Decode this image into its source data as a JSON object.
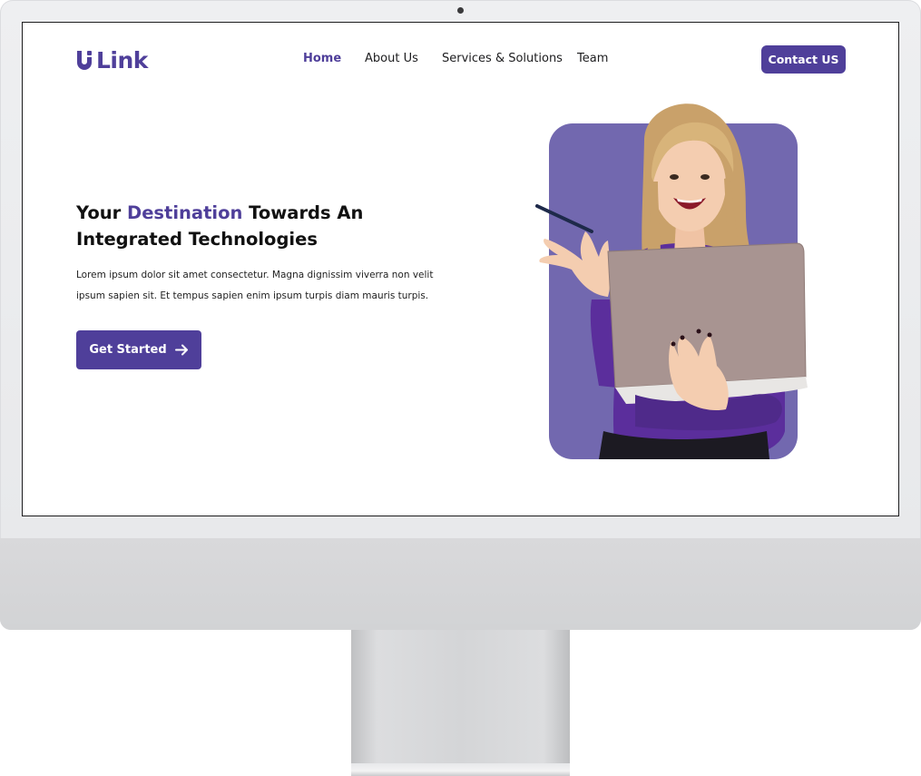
{
  "brand": {
    "name": "Link",
    "color": "#4f3f9a",
    "logo_icon": "u-logo-mark-icon"
  },
  "nav": {
    "items": [
      {
        "label": "Home",
        "active": true
      },
      {
        "label": "About Us",
        "active": false
      },
      {
        "label": "Services & Solutions",
        "active": false
      },
      {
        "label": "Team",
        "active": false
      }
    ],
    "contact_label": "Contact US"
  },
  "hero": {
    "title_prefix": "Your ",
    "title_accent": "Destination",
    "title_suffix": " Towards An Integrated Technologies",
    "body_line1": "Lorem ipsum dolor sit amet consectetur. Magna dignissim viverra non velit",
    "body_line2": "ipsum sapien sit. Et tempus sapien enim ipsum turpis diam mauris turpis.",
    "cta_label": "Get Started",
    "cta_icon": "arrow-right-icon",
    "image_bg_color": "#7268af",
    "image_subject": "woman-holding-laptop-image"
  },
  "colors": {
    "accent": "#4f3f9a",
    "text": "#111111",
    "card": "#7268af"
  }
}
